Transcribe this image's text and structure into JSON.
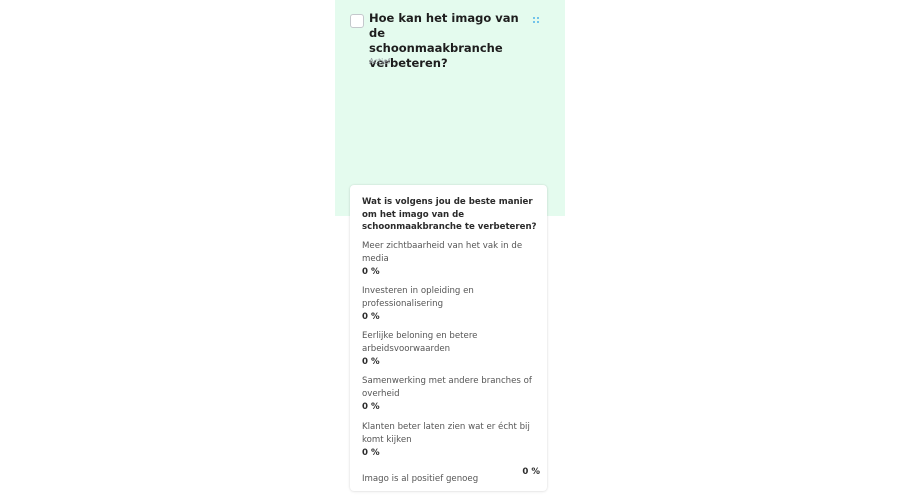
{
  "poll": {
    "title": "Hoe kan het imago van de schoonmaakbranche verbeteren?",
    "status": "Actief",
    "drag_icon": "drag-handle-icon",
    "question": "Wat is volgens jou de beste manier om het imago van de schoonmaakbranche te verbeteren?",
    "options": [
      {
        "label": "Meer zichtbaarheid van het vak in de media",
        "percent": "0 %"
      },
      {
        "label": "Investeren in opleiding en professionalisering",
        "percent": "0 %"
      },
      {
        "label": "Eerlijke beloning en betere arbeidsvoorwaarden",
        "percent": "0 %"
      },
      {
        "label": "Samenwerking met andere branches of overheid",
        "percent": "0 %"
      },
      {
        "label": "Klanten beter laten zien wat er écht bij komt kijken",
        "percent": "0 %"
      },
      {
        "label": "Imago is al positief genoeg",
        "percent": "0 %"
      }
    ]
  },
  "colors": {
    "header_bg": "#e4fbee",
    "accent": "#4fb3ea"
  }
}
